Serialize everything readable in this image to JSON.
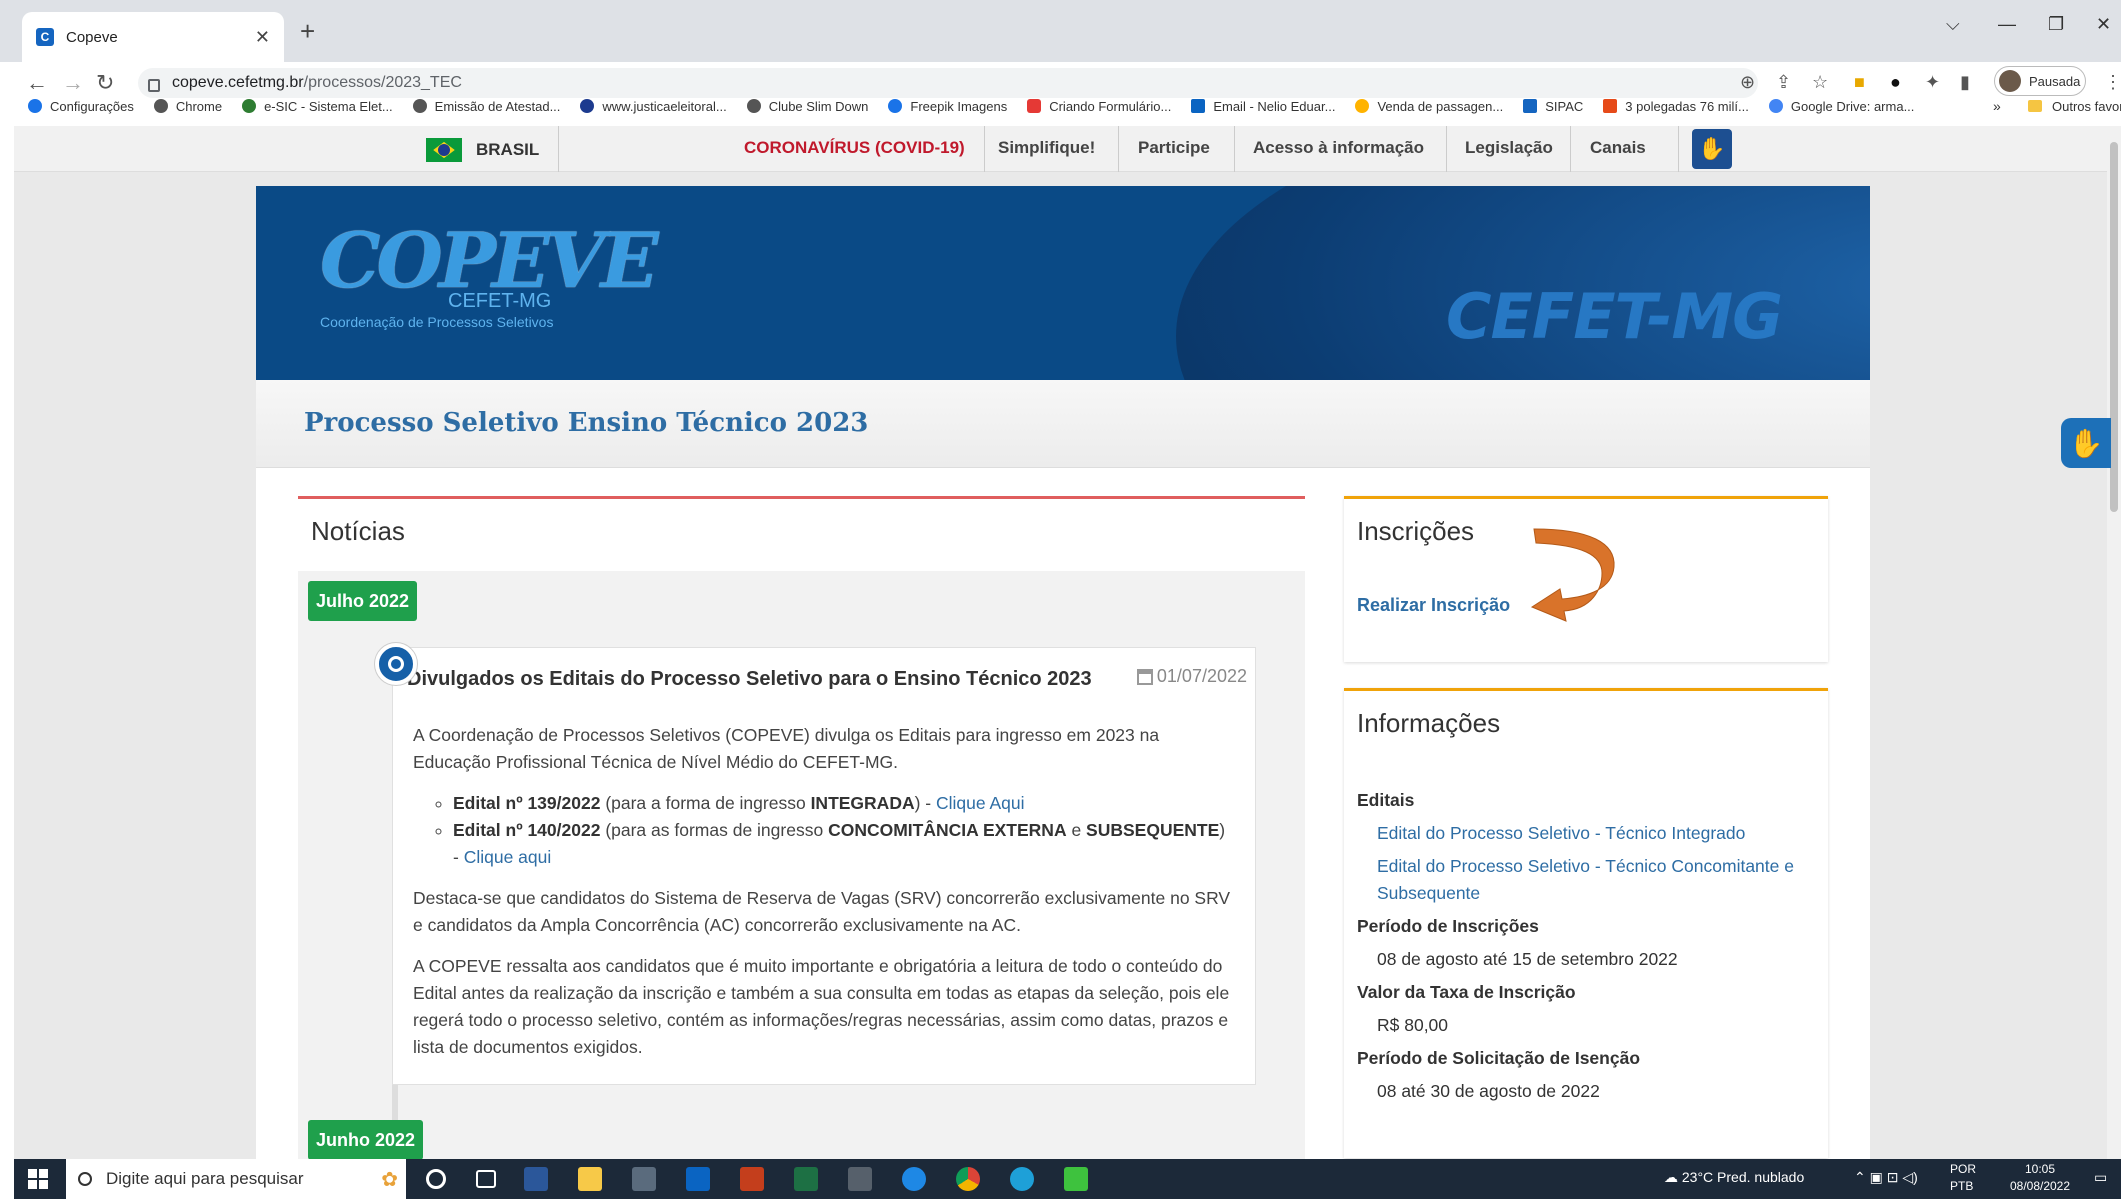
{
  "browser": {
    "tab_title": "Copeve",
    "tab_icon": "C",
    "url_host": "copeve.cefetmg.br",
    "url_path": "/processos/2023_TEC",
    "profile_label": "Pausada",
    "bookmarks": [
      "Configurações",
      "Chrome",
      "e-SIC - Sistema Elet...",
      "Emissão de Atestad...",
      "www.justicaeleitoral...",
      "Clube Slim Down",
      "Freepik Imagens",
      "Criando Formulário...",
      "Email - Nelio Eduar...",
      "Venda de passagen...",
      "SIPAC",
      "3 polegadas 76 milí...",
      "Google Drive: arma..."
    ],
    "bookmarks_more": "»",
    "bookmarks_other": "Outros favoritos"
  },
  "govbar": {
    "brasil": "BRASIL",
    "links": [
      "CORONAVÍRUS (COVID-19)",
      "Simplifique!",
      "Participe",
      "Acesso à informação",
      "Legislação",
      "Canais"
    ]
  },
  "banner": {
    "logo_main": "COPEVE",
    "logo_sub": "CEFET-MG",
    "logo_sub2": "Coordenação de Processos Seletivos",
    "brand_right": "CEFET-MG"
  },
  "page": {
    "title": "Processo Seletivo Ensino Técnico 2023"
  },
  "news": {
    "title": "Notícias",
    "months": [
      "Julho 2022",
      "Junho 2022"
    ],
    "item": {
      "title": "Divulgados os Editais do Processo Seletivo para o Ensino Técnico 2023",
      "date": "01/07/2022",
      "p1": "A Coordenação de Processos Seletivos (COPEVE) divulga os Editais para ingresso em 2023 na Educação Profissional Técnica de Nível Médio do CEFET-MG.",
      "b1_bold": "Edital nº 139/2022",
      "b1_text1": " (para a forma de ingresso ",
      "b1_bold2": "INTEGRADA",
      "b1_text2": ") - ",
      "b1_link": "Clique Aqui",
      "b2_bold": "Edital nº 140/2022",
      "b2_text1": " (para as formas de ingresso ",
      "b2_bold2": "CONCOMITÂNCIA EXTERNA",
      "b2_text2": " e ",
      "b2_bold3": "SUBSEQUENTE",
      "b2_text3": ") - ",
      "b2_link": "Clique aqui",
      "p2": "Destaca-se que candidatos do Sistema de Reserva de Vagas (SRV) concorrerão exclusivamente no SRV e candidatos da Ampla Concorrência (AC) concorrerão exclusivamente na AC.",
      "p3": "A COPEVE ressalta aos candidatos que é muito importante e obrigatória a leitura de todo o conteúdo do Edital antes da realização da inscrição e também a sua consulta em todas as etapas da seleção, pois ele regerá todo o processo seletivo, contém as informações/regras necessárias, assim como datas, prazos e lista de documentos exigidos."
    }
  },
  "inscricoes": {
    "title": "Inscrições",
    "link": "Realizar Inscrição"
  },
  "info": {
    "title": "Informações",
    "editais_h": "Editais",
    "edital1": "Edital do Processo Seletivo - Técnico Integrado",
    "edital2": "Edital do Processo Seletivo - Técnico Concomitante e Subsequente",
    "periodo_h": "Período de Inscrições",
    "periodo": "08 de agosto até 15 de setembro 2022",
    "taxa_h": "Valor da Taxa de Inscrição",
    "taxa": "R$ 80,00",
    "isencao_h": "Período de Solicitação de Isenção",
    "isencao": "08 até 30 de agosto de 2022"
  },
  "taskbar": {
    "search_placeholder": "Digite aqui para pesquisar",
    "weather": "23°C  Pred. nublado",
    "lang1": "POR",
    "lang2": "PTB",
    "time": "10:05",
    "date": "08/08/2022"
  },
  "colors": {
    "accent_blue": "#2e6da4",
    "banner": "#0a4a86",
    "month_badge": "#1fa04c",
    "covid_red": "#c0192c",
    "panel_border": "#f0a30a",
    "arrow": "#d9732a"
  }
}
